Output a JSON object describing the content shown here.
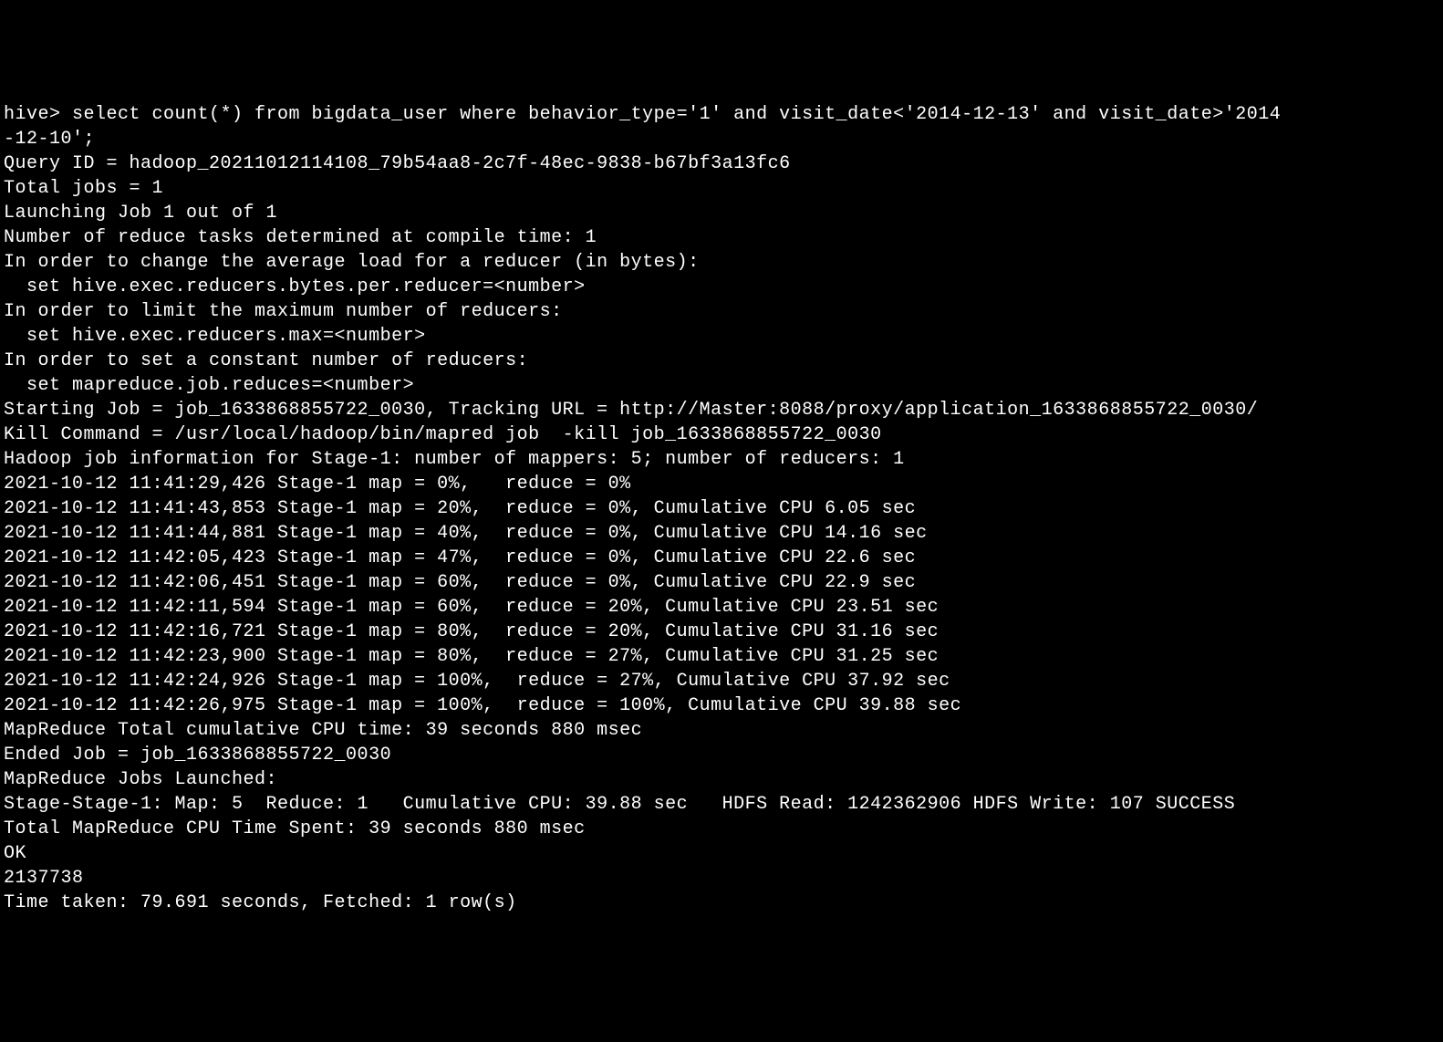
{
  "terminal": {
    "lines": [
      "hive> select count(*) from bigdata_user where behavior_type='1' and visit_date<'2014-12-13' and visit_date>'2014-12-10';",
      "Query ID = hadoop_20211012114108_79b54aa8-2c7f-48ec-9838-b67bf3a13fc6",
      "Total jobs = 1",
      "Launching Job 1 out of 1",
      "Number of reduce tasks determined at compile time: 1",
      "In order to change the average load for a reducer (in bytes):",
      "  set hive.exec.reducers.bytes.per.reducer=<number>",
      "In order to limit the maximum number of reducers:",
      "  set hive.exec.reducers.max=<number>",
      "In order to set a constant number of reducers:",
      "  set mapreduce.job.reduces=<number>",
      "Starting Job = job_1633868855722_0030, Tracking URL = http://Master:8088/proxy/application_1633868855722_0030/",
      "Kill Command = /usr/local/hadoop/bin/mapred job  -kill job_1633868855722_0030",
      "Hadoop job information for Stage-1: number of mappers: 5; number of reducers: 1",
      "2021-10-12 11:41:29,426 Stage-1 map = 0%,   reduce = 0%",
      "2021-10-12 11:41:43,853 Stage-1 map = 20%,  reduce = 0%, Cumulative CPU 6.05 sec",
      "2021-10-12 11:41:44,881 Stage-1 map = 40%,  reduce = 0%, Cumulative CPU 14.16 sec",
      "2021-10-12 11:42:05,423 Stage-1 map = 47%,  reduce = 0%, Cumulative CPU 22.6 sec",
      "2021-10-12 11:42:06,451 Stage-1 map = 60%,  reduce = 0%, Cumulative CPU 22.9 sec",
      "2021-10-12 11:42:11,594 Stage-1 map = 60%,  reduce = 20%, Cumulative CPU 23.51 sec",
      "2021-10-12 11:42:16,721 Stage-1 map = 80%,  reduce = 20%, Cumulative CPU 31.16 sec",
      "2021-10-12 11:42:23,900 Stage-1 map = 80%,  reduce = 27%, Cumulative CPU 31.25 sec",
      "2021-10-12 11:42:24,926 Stage-1 map = 100%,  reduce = 27%, Cumulative CPU 37.92 sec",
      "2021-10-12 11:42:26,975 Stage-1 map = 100%,  reduce = 100%, Cumulative CPU 39.88 sec",
      "MapReduce Total cumulative CPU time: 39 seconds 880 msec",
      "Ended Job = job_1633868855722_0030",
      "MapReduce Jobs Launched:",
      "Stage-Stage-1: Map: 5  Reduce: 1   Cumulative CPU: 39.88 sec   HDFS Read: 1242362906 HDFS Write: 107 SUCCESS",
      "Total MapReduce CPU Time Spent: 39 seconds 880 msec",
      "OK",
      "2137738",
      "Time taken: 79.691 seconds, Fetched: 1 row(s)"
    ]
  }
}
